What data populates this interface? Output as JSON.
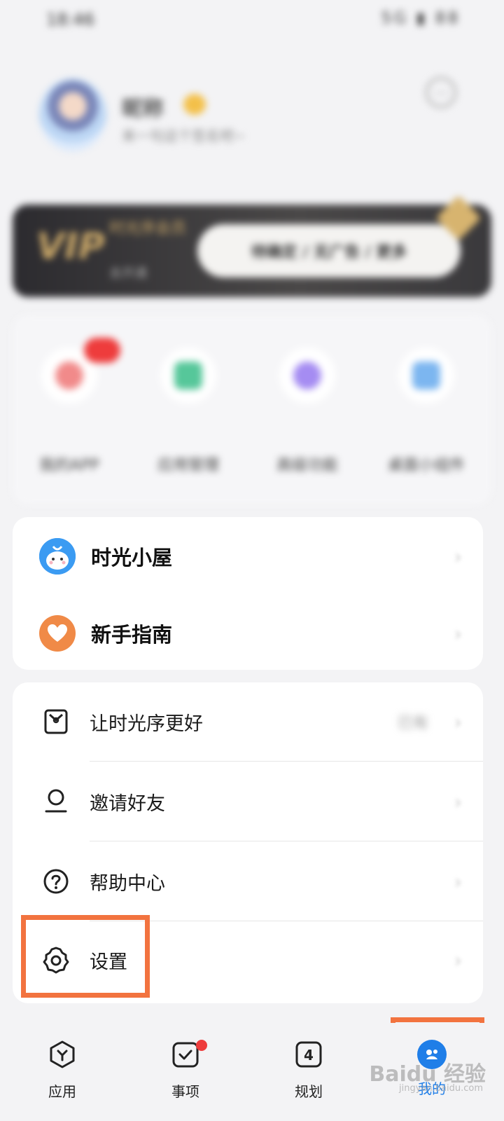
{
  "status_bar": {
    "time": "18:46",
    "icons": "5G ▮ 88"
  },
  "profile": {
    "name": "昵称",
    "bio": "来一句这个签名吧~"
  },
  "vip": {
    "logo": "VIP",
    "title": "时光序会员",
    "sub": "去开通",
    "cta": "待确定 / 无广告 / 更多"
  },
  "quick_tools": [
    {
      "label": "我的APP",
      "color": "#f18a8a"
    },
    {
      "label": "应用管理",
      "color": "#56c79a"
    },
    {
      "label": "高级功能",
      "color": "#a58cf2"
    },
    {
      "label": "桌面小组件",
      "color": "#7cb6f0"
    }
  ],
  "features": [
    {
      "label": "时光小屋",
      "icon": "cloud-character-icon",
      "color": "#3b9bf2"
    },
    {
      "label": "新手指南",
      "icon": "heart-icon",
      "color": "#f08a47"
    }
  ],
  "menu": [
    {
      "label": "让时光序更好",
      "icon": "feedback-icon",
      "value": "已有"
    },
    {
      "label": "邀请好友",
      "icon": "user-icon",
      "value": ""
    },
    {
      "label": "帮助中心",
      "icon": "help-icon",
      "value": ""
    },
    {
      "label": "设置",
      "icon": "settings-icon",
      "value": ""
    }
  ],
  "tabs": [
    {
      "label": "应用",
      "icon": "apps-icon"
    },
    {
      "label": "事项",
      "icon": "task-check-icon"
    },
    {
      "label": "规划",
      "icon": "plan-four-icon",
      "glyph": "4"
    },
    {
      "label": "我的",
      "icon": "profile-tab-icon",
      "active": true
    }
  ],
  "watermark": {
    "text": "Baidu 经验",
    "sub": "jingyan.baidu.com"
  },
  "colors": {
    "accent": "#1f7ee8",
    "highlight": "#f2733f",
    "badge": "#ee3c3c"
  }
}
